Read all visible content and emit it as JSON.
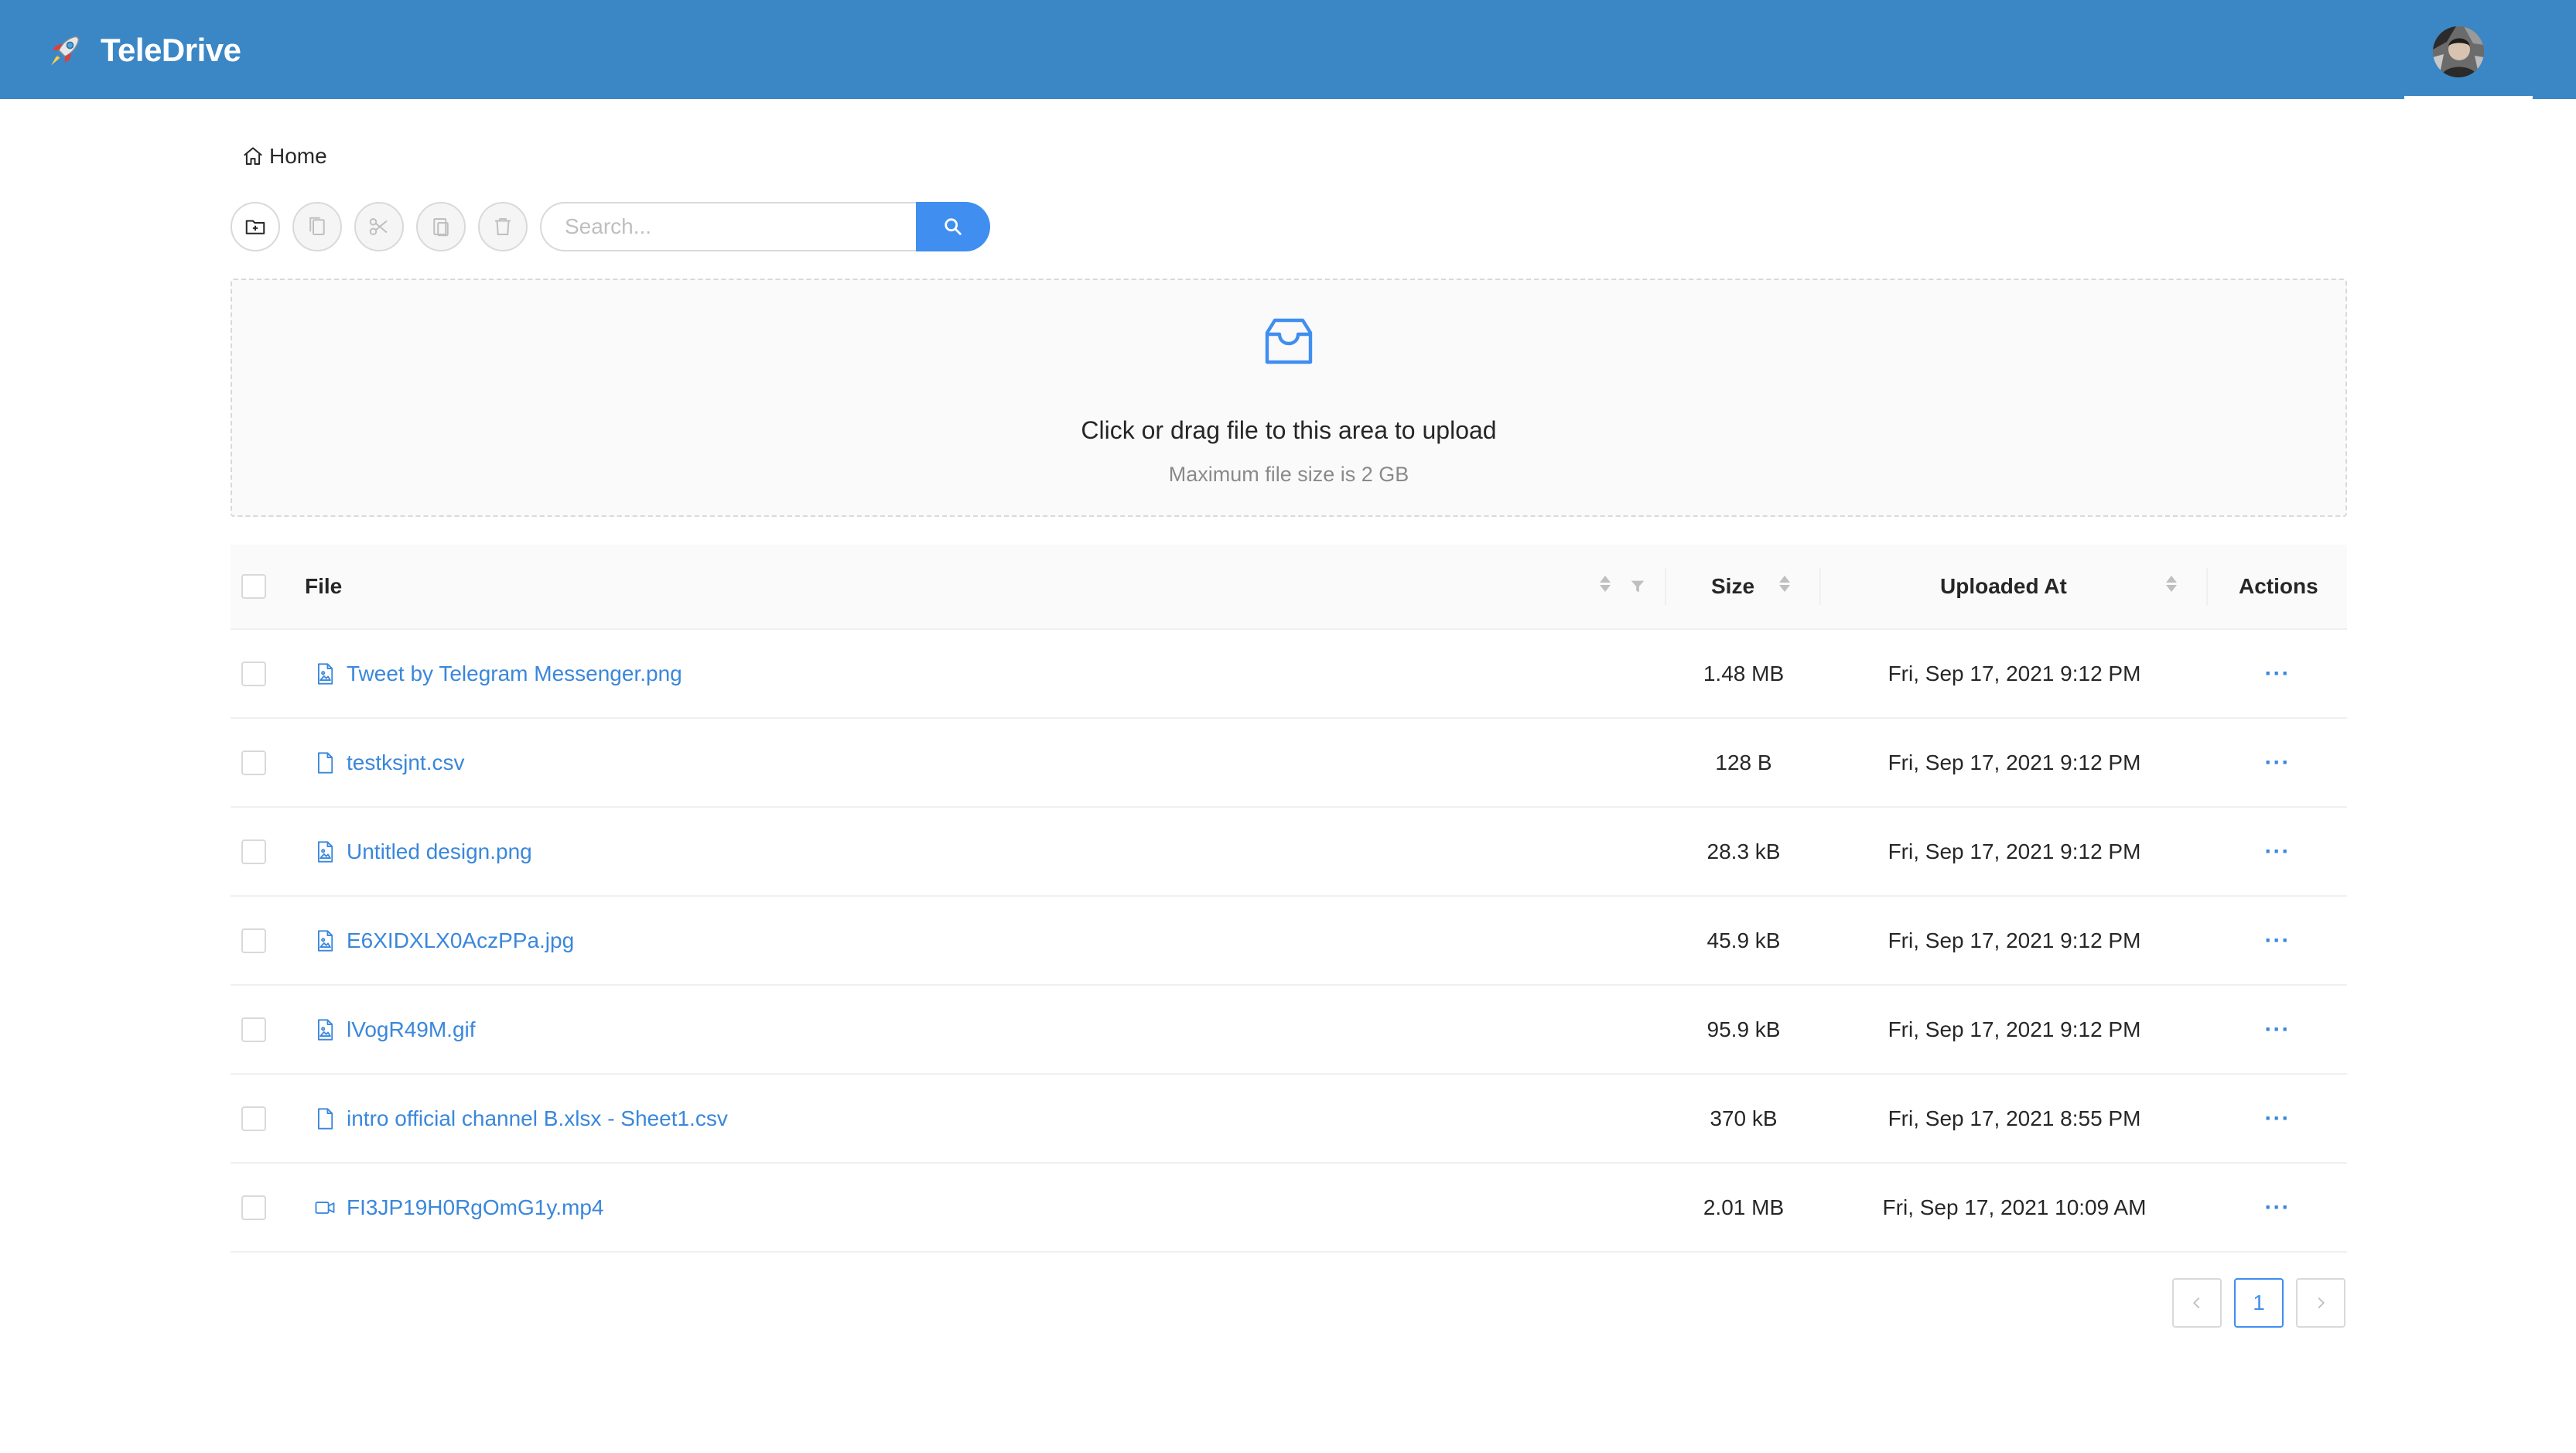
{
  "header": {
    "app_title": "TeleDrive",
    "brand_color": "#3b87c6"
  },
  "breadcrumb": {
    "home_label": "Home"
  },
  "toolbar": {
    "buttons": [
      "new-folder-icon",
      "copy-icon",
      "cut-icon",
      "paste-icon",
      "delete-icon"
    ],
    "search_placeholder": "Search..."
  },
  "upload": {
    "title": "Click or drag file to this area to upload",
    "hint": "Maximum file size is 2 GB"
  },
  "table": {
    "columns": {
      "file": "File",
      "size": "Size",
      "uploaded_at": "Uploaded At",
      "actions": "Actions"
    },
    "rows": [
      {
        "name": "Tweet by Telegram Messenger.png",
        "icon": "image-file-icon",
        "size": "1.48 MB",
        "uploaded_at": "Fri, Sep 17, 2021 9:12 PM",
        "action": "···"
      },
      {
        "name": "testksjnt.csv",
        "icon": "file-icon",
        "size": "128 B",
        "uploaded_at": "Fri, Sep 17, 2021 9:12 PM",
        "action": "···"
      },
      {
        "name": "Untitled design.png",
        "icon": "image-file-icon",
        "size": "28.3 kB",
        "uploaded_at": "Fri, Sep 17, 2021 9:12 PM",
        "action": "···"
      },
      {
        "name": "E6XIDXLX0AczPPa.jpg",
        "icon": "image-file-icon",
        "size": "45.9 kB",
        "uploaded_at": "Fri, Sep 17, 2021 9:12 PM",
        "action": "···"
      },
      {
        "name": "lVogR49M.gif",
        "icon": "image-file-icon",
        "size": "95.9 kB",
        "uploaded_at": "Fri, Sep 17, 2021 9:12 PM",
        "action": "···"
      },
      {
        "name": "intro official channel B.xlsx - Sheet1.csv",
        "icon": "file-icon",
        "size": "370 kB",
        "uploaded_at": "Fri, Sep 17, 2021 8:55 PM",
        "action": "···"
      },
      {
        "name": "FI3JP19H0RgOmG1y.mp4",
        "icon": "video-file-icon",
        "size": "2.01 MB",
        "uploaded_at": "Fri, Sep 17, 2021 10:09 AM",
        "action": "···"
      }
    ]
  },
  "pagination": {
    "current_page": "1"
  }
}
